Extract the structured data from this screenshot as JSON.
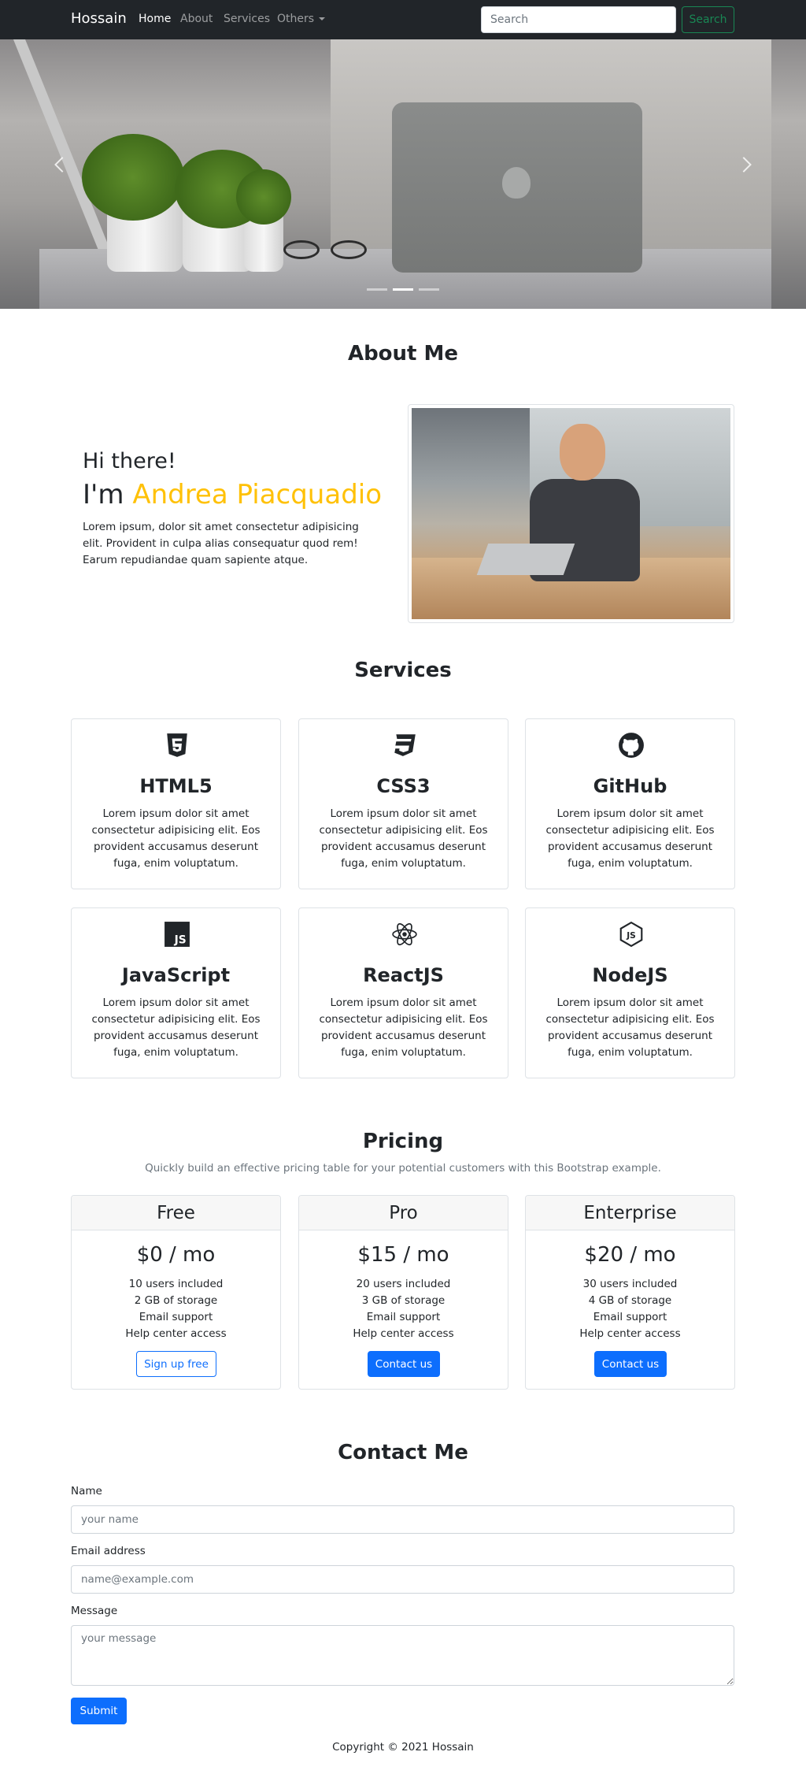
{
  "navbar": {
    "brand": "Hossain",
    "links": [
      "Home",
      "About",
      "Services",
      "Others"
    ],
    "search_placeholder": "Search",
    "search_button": "Search"
  },
  "carousel": {
    "slide_count": 3,
    "active_slide": 2
  },
  "about": {
    "title": "About Me",
    "greeting": "Hi there!",
    "im": "I'm",
    "name": "Andrea Piacquadio",
    "text": "Lorem ipsum, dolor sit amet consectetur adipisicing elit. Provident in culpa alias consequatur quod rem! Earum repudiandae quam sapiente atque."
  },
  "services": {
    "title": "Services",
    "items": [
      {
        "icon": "html5-icon",
        "title": "HTML5",
        "text": "Lorem ipsum dolor sit amet consectetur adipisicing elit. Eos provident accusamus deserunt fuga, enim voluptatum."
      },
      {
        "icon": "css3-icon",
        "title": "CSS3",
        "text": "Lorem ipsum dolor sit amet consectetur adipisicing elit. Eos provident accusamus deserunt fuga, enim voluptatum."
      },
      {
        "icon": "github-icon",
        "title": "GitHub",
        "text": "Lorem ipsum dolor sit amet consectetur adipisicing elit. Eos provident accusamus deserunt fuga, enim voluptatum."
      },
      {
        "icon": "javascript-icon",
        "title": "JavaScript",
        "text": "Lorem ipsum dolor sit amet consectetur adipisicing elit. Eos provident accusamus deserunt fuga, enim voluptatum."
      },
      {
        "icon": "react-icon",
        "title": "ReactJS",
        "text": "Lorem ipsum dolor sit amet consectetur adipisicing elit. Eos provident accusamus deserunt fuga, enim voluptatum."
      },
      {
        "icon": "nodejs-icon",
        "title": "NodeJS",
        "text": "Lorem ipsum dolor sit amet consectetur adipisicing elit. Eos provident accusamus deserunt fuga, enim voluptatum."
      }
    ]
  },
  "pricing": {
    "title": "Pricing",
    "lead": "Quickly build an effective pricing table for your potential customers with this Bootstrap example.",
    "plans": [
      {
        "name": "Free",
        "price": "$0 / mo",
        "features": [
          "10 users included",
          "2 GB of storage",
          "Email support",
          "Help center access"
        ],
        "button": "Sign up free"
      },
      {
        "name": "Pro",
        "price": "$15 / mo",
        "features": [
          "20 users included",
          "3 GB of storage",
          "Email support",
          "Help center access"
        ],
        "button": "Contact us"
      },
      {
        "name": "Enterprise",
        "price": "$20 / mo",
        "features": [
          "30 users included",
          "4 GB of storage",
          "Email support",
          "Help center access"
        ],
        "button": "Contact us"
      }
    ]
  },
  "contact": {
    "title": "Contact Me",
    "name_label": "Name",
    "name_placeholder": "your name",
    "email_label": "Email address",
    "email_placeholder": "name@example.com",
    "message_label": "Message",
    "message_placeholder": "your message",
    "submit": "Submit"
  },
  "footer": {
    "copyright": "Copyright © 2021 Hossain"
  },
  "colors": {
    "accent": "#ffc107",
    "primary": "#0d6efd",
    "success": "#198754",
    "navbar": "#212529"
  }
}
